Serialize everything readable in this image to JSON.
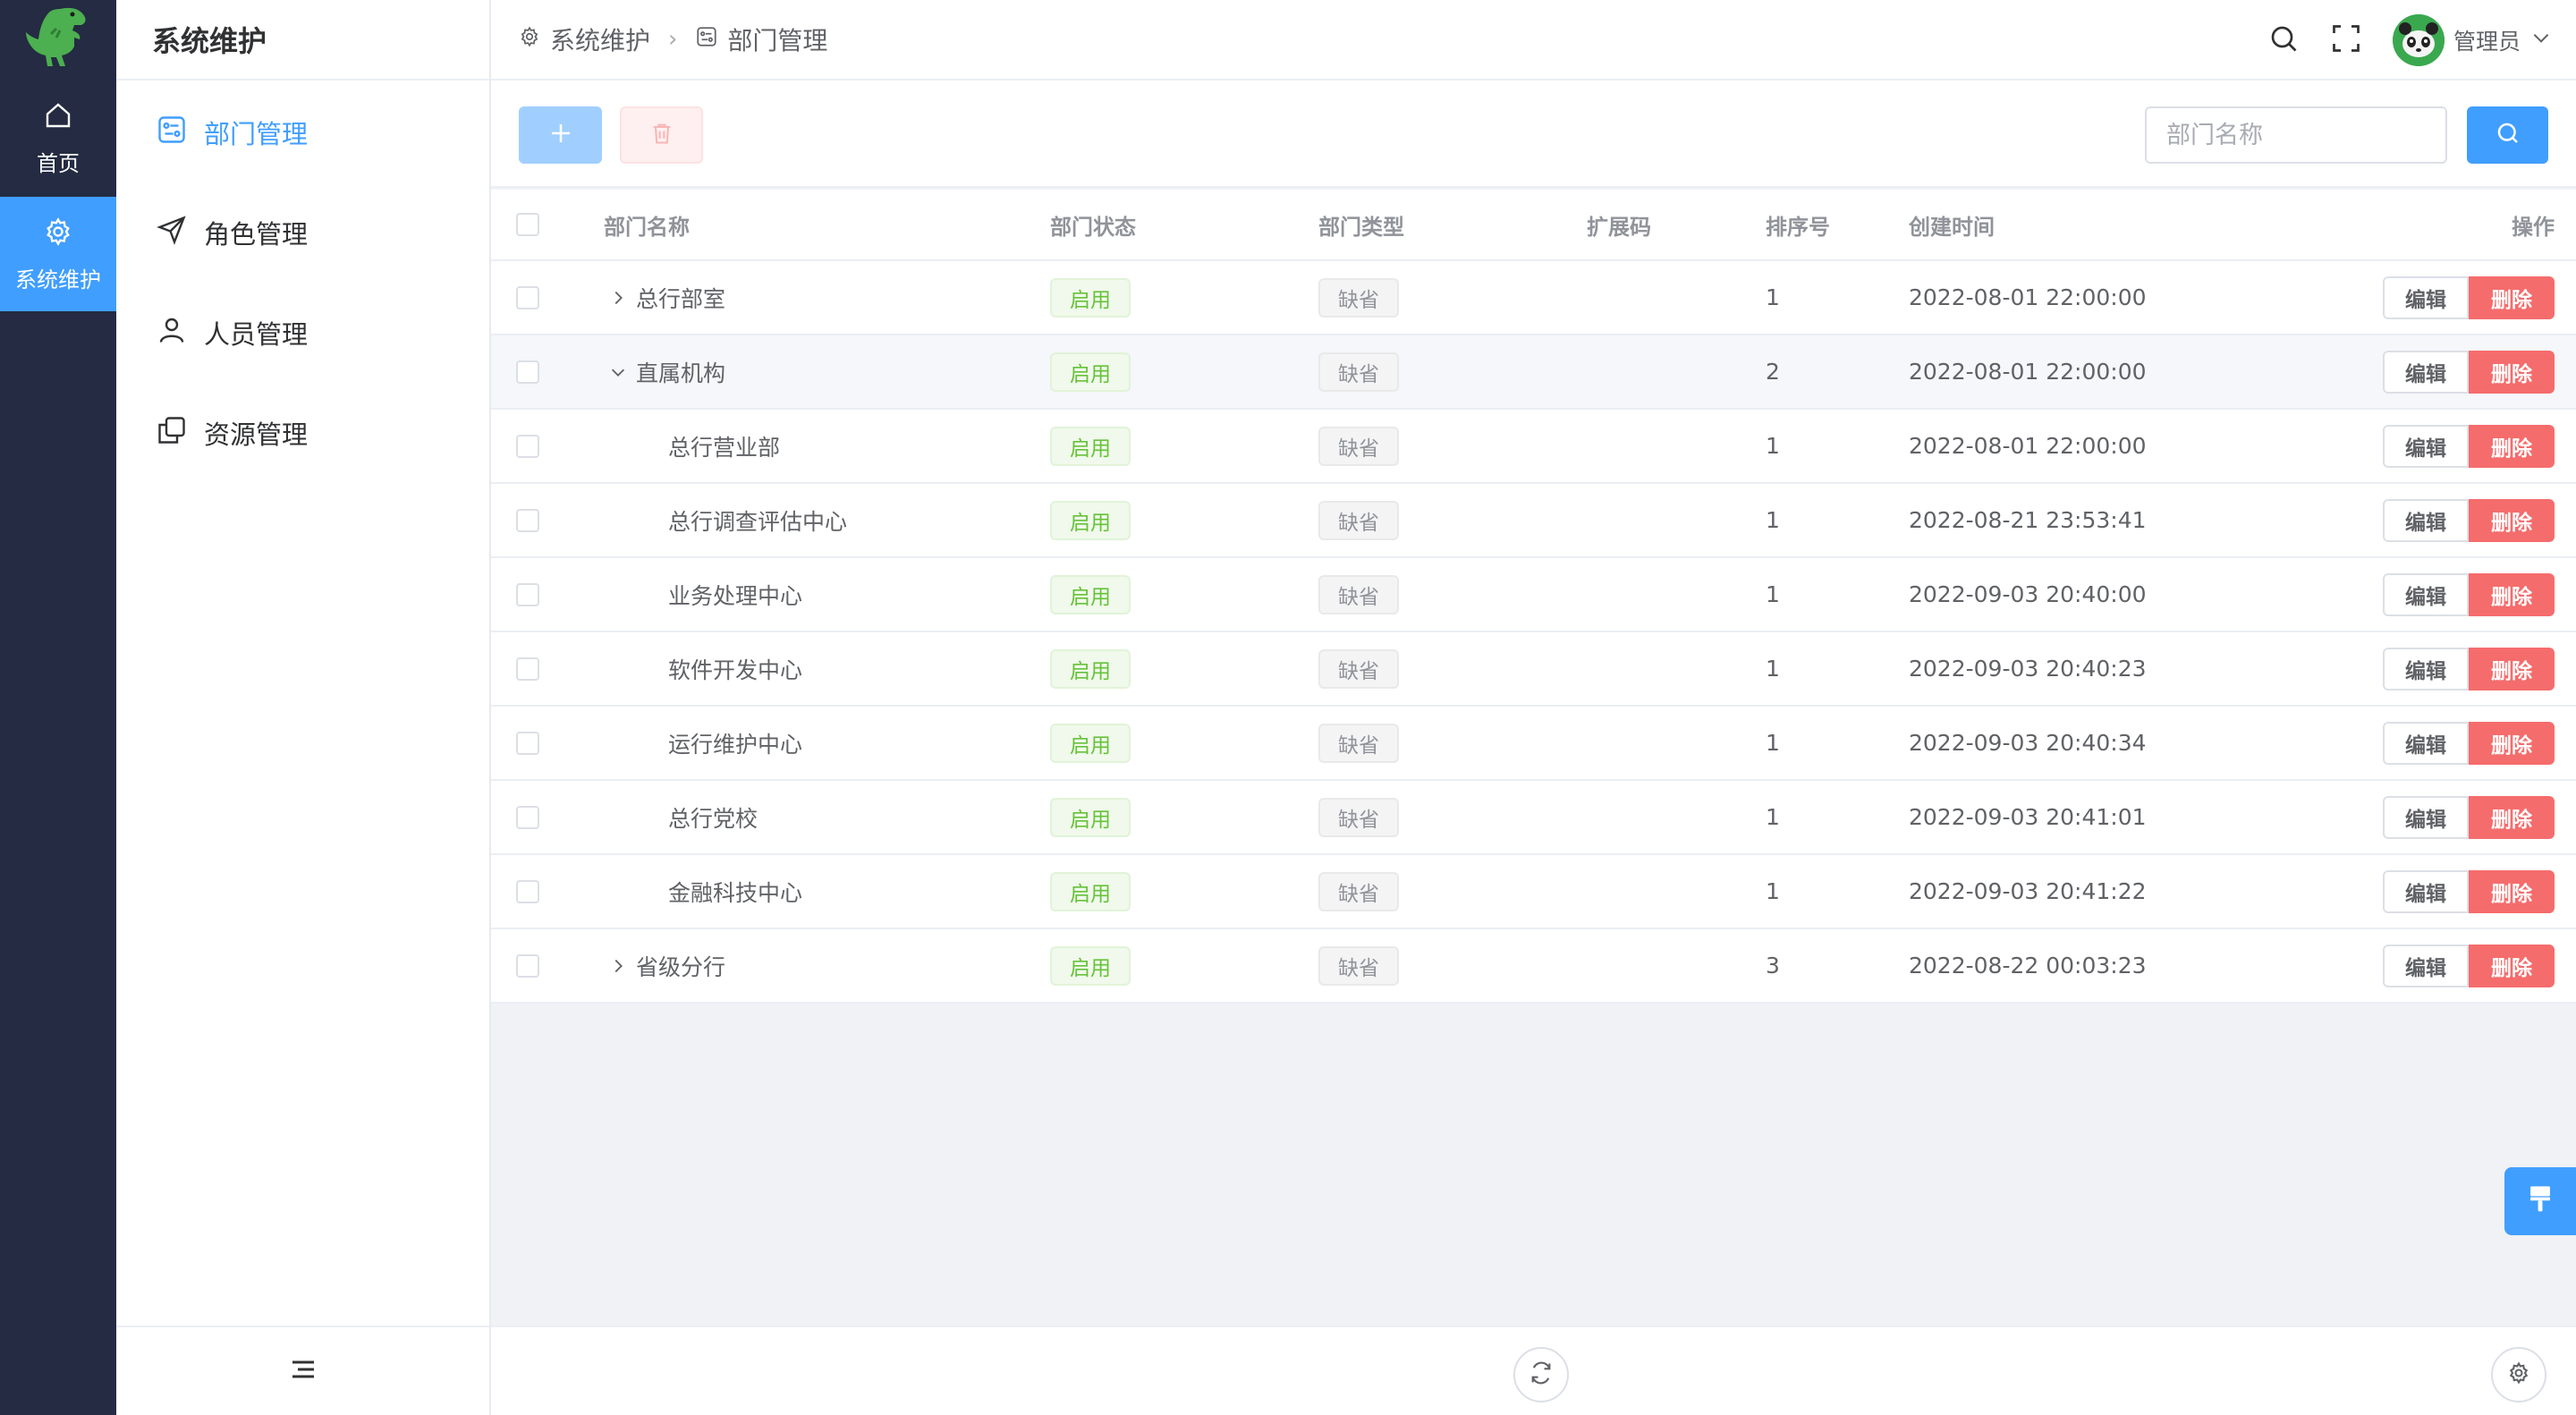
{
  "rail": {
    "logo_icon": "dinosaur-logo",
    "items": [
      {
        "label": "首页",
        "icon": "home-icon",
        "active": false
      },
      {
        "label": "系统维护",
        "icon": "gear-icon",
        "active": true
      }
    ]
  },
  "submenu": {
    "title": "系统维护",
    "items": [
      {
        "label": "部门管理",
        "icon": "department-icon",
        "active": true
      },
      {
        "label": "角色管理",
        "icon": "send-icon",
        "active": false
      },
      {
        "label": "人员管理",
        "icon": "user-icon",
        "active": false
      },
      {
        "label": "资源管理",
        "icon": "copy-icon",
        "active": false
      }
    ],
    "collapse_icon": "collapse-menu-icon"
  },
  "header": {
    "breadcrumb": [
      "系统维护",
      "部门管理"
    ],
    "user_name": "管理员"
  },
  "toolbar": {
    "search_placeholder": "部门名称",
    "search_value": ""
  },
  "table": {
    "columns": {
      "name": "部门名称",
      "status": "部门状态",
      "type": "部门类型",
      "ext": "扩展码",
      "sort": "排序号",
      "time": "创建时间",
      "op": "操作"
    },
    "rows": [
      {
        "name": "总行部室",
        "status": "启用",
        "type": "缺省",
        "ext": "",
        "sort": "1",
        "time": "2022-08-01 22:00:00",
        "edit": "编辑",
        "remove": "删除"
      },
      {
        "name": "直属机构",
        "status": "启用",
        "type": "缺省",
        "ext": "",
        "sort": "2",
        "time": "2022-08-01 22:00:00",
        "edit": "编辑",
        "remove": "删除"
      },
      {
        "name": "总行营业部",
        "status": "启用",
        "type": "缺省",
        "ext": "",
        "sort": "1",
        "time": "2022-08-01 22:00:00",
        "edit": "编辑",
        "remove": "删除"
      },
      {
        "name": "总行调查评估中心",
        "status": "启用",
        "type": "缺省",
        "ext": "",
        "sort": "1",
        "time": "2022-08-21 23:53:41",
        "edit": "编辑",
        "remove": "删除"
      },
      {
        "name": "业务处理中心",
        "status": "启用",
        "type": "缺省",
        "ext": "",
        "sort": "1",
        "time": "2022-09-03 20:40:00",
        "edit": "编辑",
        "remove": "删除"
      },
      {
        "name": "软件开发中心",
        "status": "启用",
        "type": "缺省",
        "ext": "",
        "sort": "1",
        "time": "2022-09-03 20:40:23",
        "edit": "编辑",
        "remove": "删除"
      },
      {
        "name": "运行维护中心",
        "status": "启用",
        "type": "缺省",
        "ext": "",
        "sort": "1",
        "time": "2022-09-03 20:40:34",
        "edit": "编辑",
        "remove": "删除"
      },
      {
        "name": "总行党校",
        "status": "启用",
        "type": "缺省",
        "ext": "",
        "sort": "1",
        "time": "2022-09-03 20:41:01",
        "edit": "编辑",
        "remove": "删除"
      },
      {
        "name": "金融科技中心",
        "status": "启用",
        "type": "缺省",
        "ext": "",
        "sort": "1",
        "time": "2022-09-03 20:41:22",
        "edit": "编辑",
        "remove": "删除"
      },
      {
        "name": "省级分行",
        "status": "启用",
        "type": "缺省",
        "ext": "",
        "sort": "3",
        "time": "2022-08-22 00:03:23",
        "edit": "编辑",
        "remove": "删除"
      }
    ]
  },
  "colors": {
    "primary": "#409eff",
    "rail_bg": "#242b42",
    "success": "#67c23a",
    "danger": "#f56c6c"
  }
}
